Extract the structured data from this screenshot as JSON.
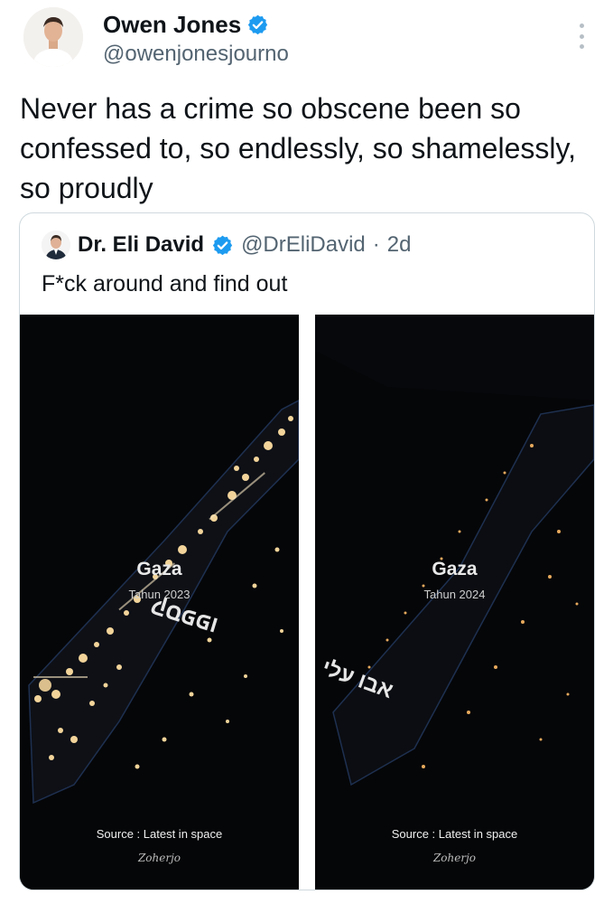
{
  "tweet": {
    "author_name": "Owen Jones",
    "author_handle": "@owenjonesjourno",
    "text": "Never has a crime so obscene been so confessed to, so endlessly, so shamelessly, so proudly"
  },
  "quoted_tweet": {
    "author_name": "Dr. Eli David",
    "author_handle": "@DrEliDavid",
    "separator": "·",
    "time_ago": "2d",
    "text": "F*ck around and find out",
    "media": {
      "left": {
        "place": "Gaza",
        "year": "Tahun 2023",
        "source": "Source : Latest in space",
        "signature": "Zoherjo",
        "watermark": "קספפו"
      },
      "right": {
        "place": "Gaza",
        "year": "Tahun 2024",
        "source": "Source : Latest in space",
        "signature": "Zoherjo",
        "watermark": "אבו עלי"
      }
    }
  },
  "colors": {
    "verified": "#1d9bf0",
    "text_primary": "#0f1419",
    "text_secondary": "#536471",
    "border": "#cfd9de",
    "satellite_bg": "#050608",
    "city_lights": "#f2d49a"
  },
  "icons": {
    "verified": "verified-badge-icon",
    "more": "more-options-icon"
  }
}
